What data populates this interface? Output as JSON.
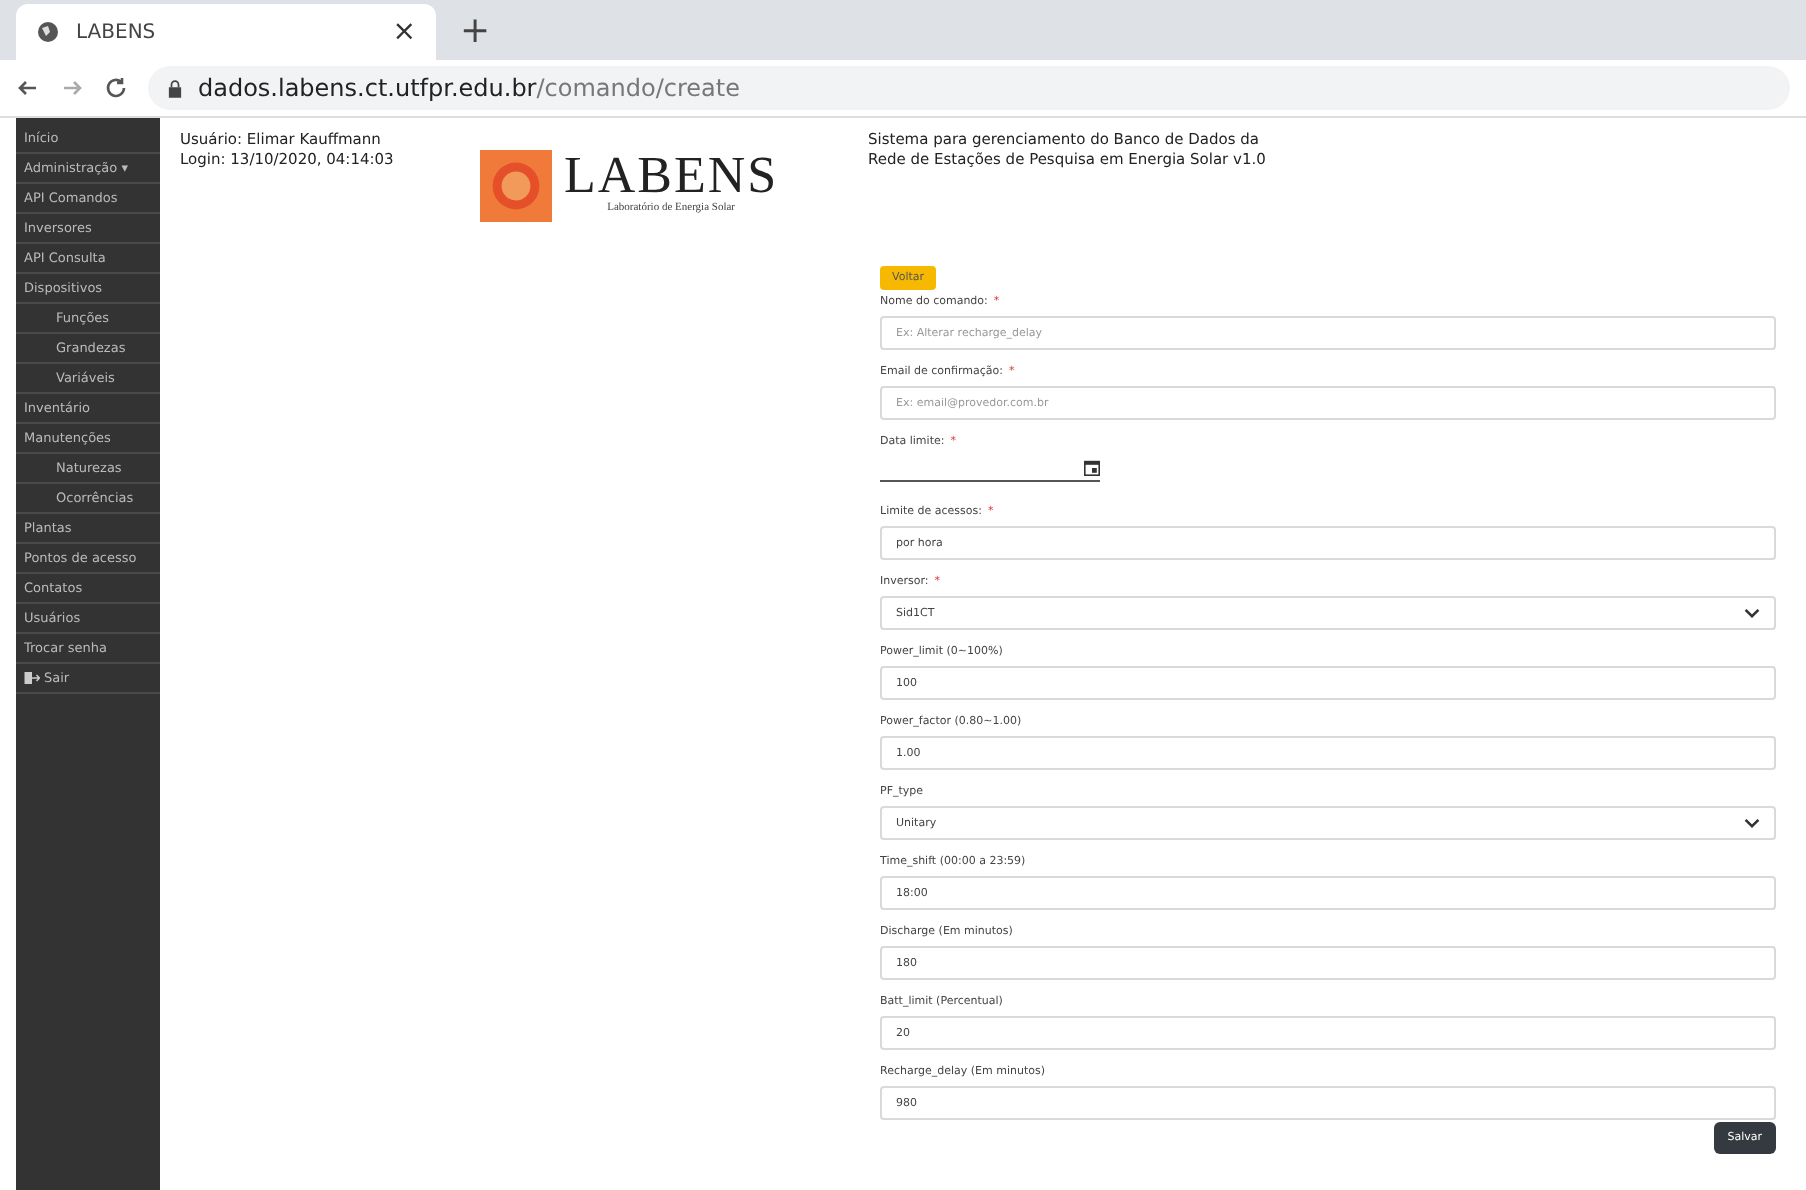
{
  "browser": {
    "tab_title": "LABENS",
    "close": "×",
    "new_tab": "+",
    "url_host": "dados.labens.ct.utfpr.edu.br",
    "url_path": "/comando/create"
  },
  "sidebar": {
    "items": [
      {
        "label": "Início"
      },
      {
        "label": "Administração ▾"
      },
      {
        "label": "API Comandos"
      },
      {
        "label": "Inversores"
      },
      {
        "label": "API Consulta"
      },
      {
        "label": "Dispositivos",
        "children": [
          {
            "label": "Funções"
          },
          {
            "label": "Grandezas"
          },
          {
            "label": "Variáveis"
          }
        ]
      },
      {
        "label": "Inventário"
      },
      {
        "label": "Manutenções",
        "children": [
          {
            "label": "Naturezas"
          },
          {
            "label": "Ocorrências"
          }
        ]
      },
      {
        "label": "Plantas"
      },
      {
        "label": "Pontos de acesso"
      },
      {
        "label": "Contatos"
      },
      {
        "label": "Usuários"
      },
      {
        "label": "Trocar senha"
      },
      {
        "label": "Sair",
        "kind": "logout"
      }
    ]
  },
  "user": {
    "name": "Usuário: Elimar Kauffmann",
    "login": "Login: 13/10/2020, 04:14:03"
  },
  "logo": {
    "title": "LABENS",
    "subtitle": "Laboratório de Energia Solar"
  },
  "system_title": [
    "Sistema para gerenciamento do Banco de Dados da",
    "Rede de Estações de Pesquisa em Energia Solar v1.0"
  ],
  "back_button": "Voltar",
  "fields": [
    {
      "kind": "text",
      "label": "Nome do comando:",
      "required_mark": "*",
      "placeholder": "Ex: Alterar recharge_delay"
    },
    {
      "kind": "text",
      "label": "Email de confirmação:",
      "required_mark": "*",
      "placeholder": "Ex: email@provedor.com.br"
    },
    {
      "kind": "date",
      "label": "Data limite:",
      "required_mark": "*"
    },
    {
      "kind": "text",
      "label": "Limite de acessos:",
      "required_mark": "*",
      "value": "por hora"
    },
    {
      "kind": "select",
      "label": "Inversor:",
      "required_mark": "*",
      "value": "Sid1CT"
    },
    {
      "kind": "text",
      "label": "Power_limit (0~100%)",
      "value": "100"
    },
    {
      "kind": "text",
      "label": "Power_factor (0.80~1.00)",
      "value": "1.00"
    },
    {
      "kind": "select",
      "label": "PF_type",
      "value": "Unitary"
    },
    {
      "kind": "text",
      "label": "Time_shift (00:00 a 23:59)",
      "value": "18:00"
    },
    {
      "kind": "text",
      "label": "Discharge (Em minutos)",
      "value": "180"
    },
    {
      "kind": "text",
      "label": "Batt_limit (Percentual)",
      "value": "20"
    },
    {
      "kind": "text",
      "label": "Recharge_delay (Em minutos)",
      "value": "980"
    }
  ],
  "save_button": "Salvar"
}
